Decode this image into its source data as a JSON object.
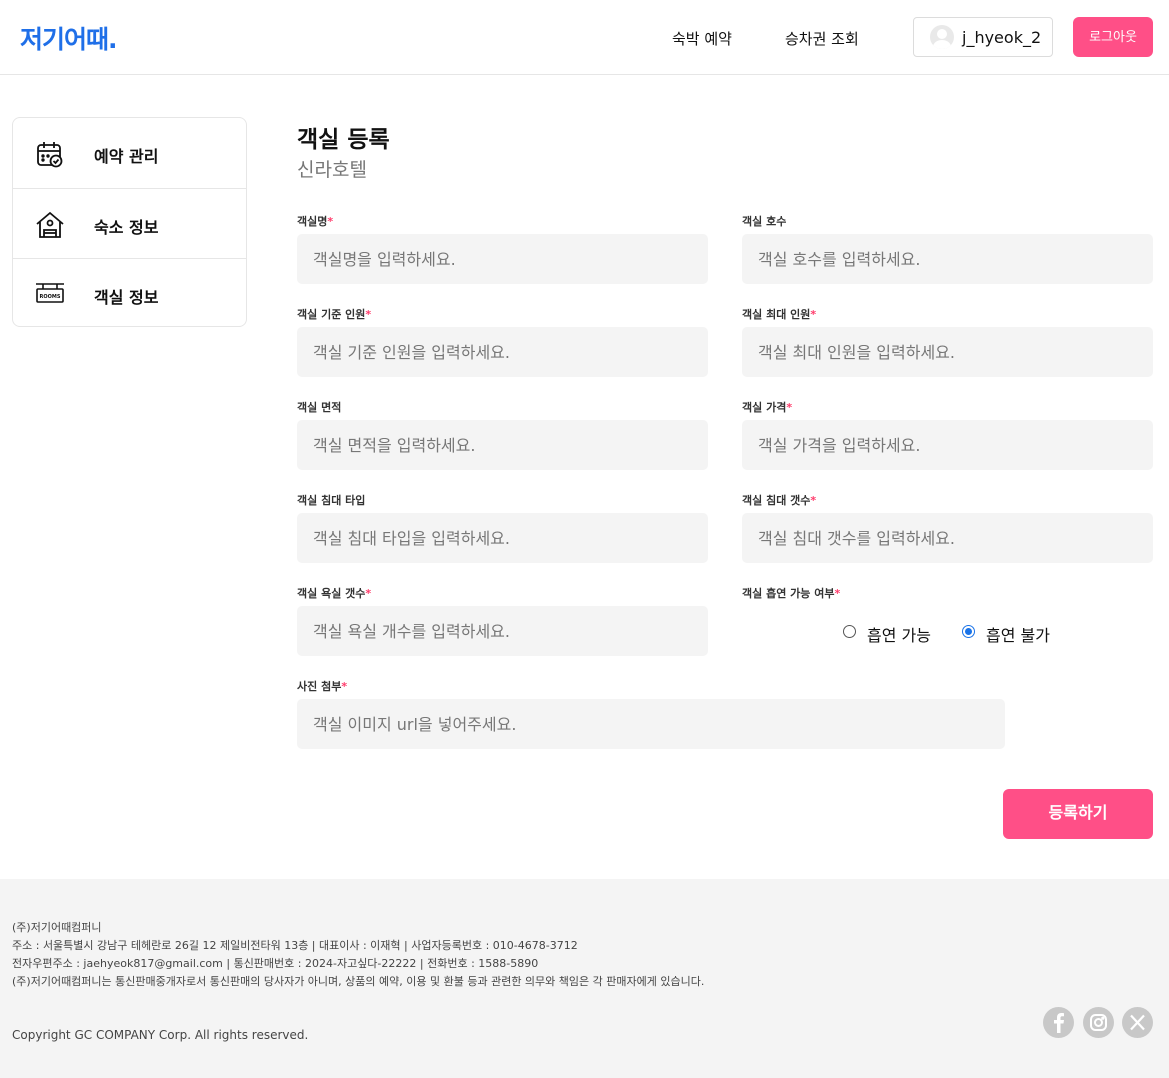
{
  "header": {
    "logo": "저기어때.",
    "nav": [
      "숙박 예약",
      "승차권 조회"
    ],
    "username": "j_hyeok_2",
    "logout_label": "로그아웃"
  },
  "sidebar": {
    "items": [
      {
        "label": "예약 관리",
        "icon": "calendar-check-icon"
      },
      {
        "label": "숙소 정보",
        "icon": "house-icon"
      },
      {
        "label": "객실 정보",
        "icon": "rooms-sign-icon"
      }
    ]
  },
  "main": {
    "title": "객실 등록",
    "subtitle": "신라호텔",
    "required_mark": "*",
    "fields": {
      "room_name": {
        "label": "객실명",
        "required": true,
        "placeholder": "객실명을 입력하세요."
      },
      "room_number": {
        "label": "객실 호수",
        "required": false,
        "placeholder": "객실 호수를 입력하세요."
      },
      "base_guests": {
        "label": "객실 기준 인원",
        "required": true,
        "placeholder": "객실 기준 인원을 입력하세요."
      },
      "max_guests": {
        "label": "객실 최대 인원",
        "required": true,
        "placeholder": "객실 최대 인원을 입력하세요."
      },
      "area": {
        "label": "객실 면적",
        "required": false,
        "placeholder": "객실 면적을 입력하세요."
      },
      "price": {
        "label": "객실 가격",
        "required": true,
        "placeholder": "객실 가격을 입력하세요."
      },
      "bed_type": {
        "label": "객실 침대 타입",
        "required": false,
        "placeholder": "객실 침대 타입을 입력하세요."
      },
      "bed_count": {
        "label": "객실 침대 갯수",
        "required": true,
        "placeholder": "객실 침대 갯수를 입력하세요."
      },
      "bath_count": {
        "label": "객실 욕실 갯수",
        "required": true,
        "placeholder": "객실 욕실 개수를 입력하세요."
      },
      "smoking": {
        "label": "객실 흡연 가능 여부",
        "required": true,
        "options": [
          "흡연 가능",
          "흡연 불가"
        ],
        "selected": "흡연 불가"
      },
      "photo": {
        "label": "사진 첨부",
        "required": true,
        "placeholder": "객실 이미지 url을 넣어주세요."
      }
    },
    "submit_label": "등록하기"
  },
  "footer": {
    "company": "(주)저기어때컴퍼니",
    "address": "주소 : 서울특별시 강남구 테헤란로 26길 12 제일비전타워 13층 | 대표이사 : 이재혁 | 사업자등록번호 : 010-4678-3712",
    "contact": "전자우편주소 : jaehyeok817@gmail.com | 통신판매번호 : 2024-자고싶다-22222 | 전화번호 : 1588-5890",
    "disclaimer": "(주)저기어때컴퍼니는 통신판매중개자로서 통신판매의 당사자가 아니며, 상품의 예약, 이용 및 환불 등과 관련한 의무와 책임은 각 판매자에게 있습니다.",
    "copyright": "Copyright GC COMPANY Corp. All rights reserved.",
    "social": [
      "facebook-icon",
      "instagram-icon",
      "x-icon"
    ]
  },
  "colors": {
    "brand": "#1f6fe8",
    "accent": "#ff4f87",
    "input_bg": "#f4f4f4",
    "required": "#ff3b6b"
  }
}
